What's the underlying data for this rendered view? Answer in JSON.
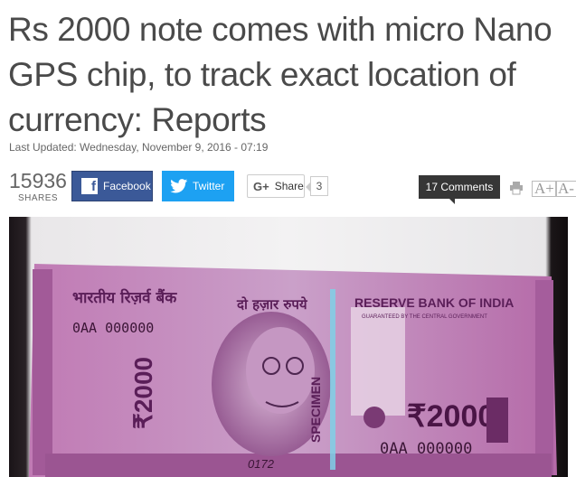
{
  "article": {
    "title": "Rs 2000 note comes with micro Nano GPS chip, to track exact location of currency: Reports",
    "last_updated": "Last Updated: Wednesday, November 9, 2016 - 07:19"
  },
  "share_bar": {
    "share_count": "15936",
    "share_label": "SHARES",
    "facebook_label": "Facebook",
    "twitter_label": "Twitter",
    "gplus_label": "Share",
    "gplus_count": "3",
    "comments_label": "17 Comments",
    "font_increase": "A+",
    "font_decrease": "A-"
  },
  "note": {
    "bank_hindi": "भारतीय रिज़र्व बैंक",
    "value_hindi": "दो हज़ार रुपये",
    "bank_english": "RESERVE BANK OF INDIA",
    "guarantee": "GUARANTEED BY THE CENTRAL GOVERNMENT",
    "serial": "0AA 000000",
    "serial_bottom": "0AA 000000",
    "denomination": "₹2000",
    "vertical_value": "₹2000",
    "specimen": "SPECIMEN",
    "plate": "0172"
  },
  "colors": {
    "facebook": "#3b5998",
    "twitter": "#1da1f2",
    "note_magenta": "#b86aa8",
    "comments_bg": "#363636"
  }
}
